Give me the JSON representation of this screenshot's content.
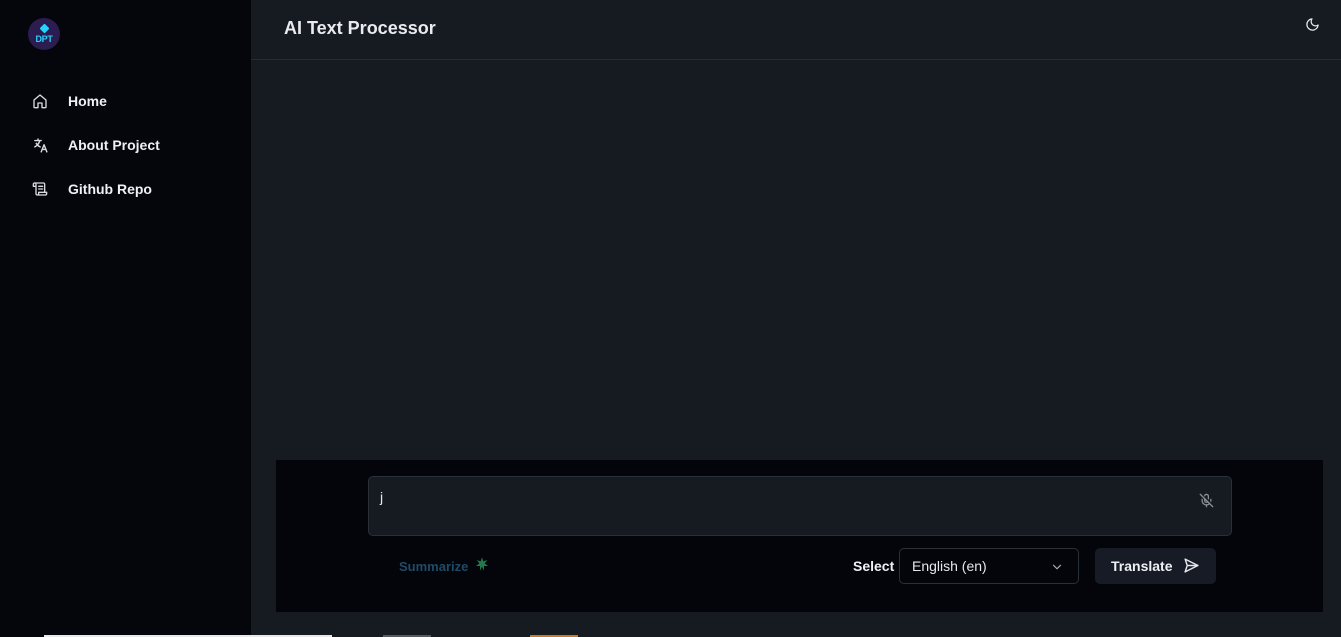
{
  "sidebar": {
    "logo": {
      "text": "DPT"
    },
    "items": [
      {
        "label": "Home",
        "icon": "home-icon"
      },
      {
        "label": "About Project",
        "icon": "translate-icon"
      },
      {
        "label": "Github Repo",
        "icon": "scroll-icon"
      }
    ]
  },
  "header": {
    "title": "AI Text Processor",
    "theme_icon": "moon-icon"
  },
  "composer": {
    "input_value": "j",
    "mic_icon": "mic-off-icon",
    "summarize_label": "Summarize",
    "summarize_icon": "sparkle-icon",
    "select_label": "Select",
    "language_selected": "English (en)",
    "translate_label": "Translate",
    "send_icon": "send-icon"
  },
  "colors": {
    "sidebar_bg": "#05060c",
    "main_bg": "#161b22",
    "composer_bg": "#03050b",
    "logo_accent": "#27d3ff",
    "summarize_text": "#1f4b66",
    "summarize_icon": "#1f7a4d"
  }
}
